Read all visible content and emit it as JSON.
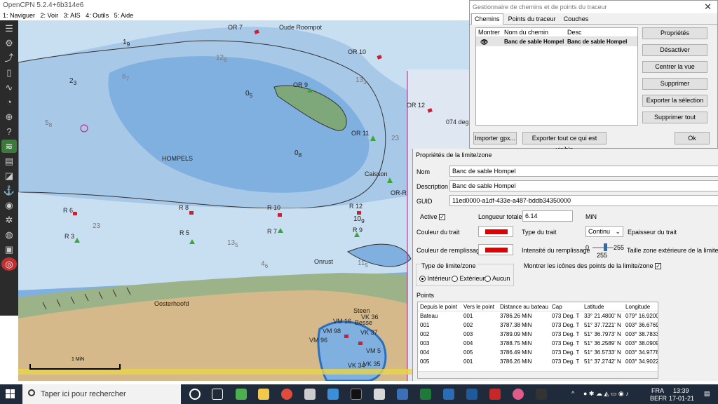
{
  "app": {
    "title": "OpenCPN 5.2.4+6b314e6",
    "menu": [
      "1: Naviguer",
      "2: Voir",
      "3: AIS",
      "4: Outils",
      "5: Aide"
    ]
  },
  "toolbar": {
    "icons": [
      "menu-icon",
      "settings-icon",
      "route-icon",
      "waypoint-icon",
      "track-icon",
      "ownship-icon",
      "zoom-in-icon",
      "help-icon",
      "tide-icon",
      "chart-icon",
      "layers-icon",
      "ais-icon",
      "mob-icon"
    ]
  },
  "chart": {
    "place_names": [
      "Oude Roompot",
      "HOMPELS",
      "Caisson",
      "Onrust",
      "Oosterhoofd",
      "Steen"
    ],
    "buoys": [
      "OR 7",
      "OR 10",
      "OR 9",
      "OR 12",
      "OR 11",
      "OR-R",
      "R 6",
      "R 8",
      "R 10",
      "R 12",
      "R 3",
      "R 5",
      "R 7",
      "R 9",
      "VM 16",
      "VM 98",
      "VM 96",
      "VM 5",
      "VK 34",
      "VK 37",
      "VK 35",
      "VK 36",
      "Besse"
    ],
    "bearing_label": "074 deg",
    "scale_label": "1 MiN"
  },
  "route_manager": {
    "title": "Gestionnaire de chemins et de points du traceur",
    "tabs": [
      "Chemins",
      "Points du traceur",
      "Couches"
    ],
    "columns": [
      "Montrer",
      "Nom du chemin",
      "Desc"
    ],
    "row": {
      "name": "Banc de sable Hompel",
      "desc": "Banc de sable Hompel"
    },
    "buttons": [
      "Propriétés",
      "Désactiver",
      "Centrer la vue",
      "Supprimer",
      "Exporter la sélection ...",
      "Supprimer tout"
    ],
    "bottom_buttons": {
      "import": "Importer gpx...",
      "export": "Exporter tout ce qui est visible",
      "ok": "Ok"
    }
  },
  "boundary": {
    "title": "Propriétés de la limite/zone",
    "name_label": "Nom",
    "name": "Banc de sable Hompel",
    "desc_label": "Description",
    "desc": "Banc de sable Hompel",
    "guid_label": "GUID",
    "guid": "11ed0000-a1df-433e-a487-bddb34350000",
    "active_label": "Active",
    "length_label": "Longueur totale",
    "length": "6.14",
    "length_unit": "MiN",
    "line_color_label": "Couleur du trait",
    "line_type_label": "Type du trait",
    "line_type": "Continu",
    "line_width_label": "Epaisseur du trait",
    "fill_color_label": "Couleur de remplissage",
    "fill_intensity_label": "Intensité du remplissage",
    "slider_min": "0",
    "slider_max": "255",
    "slider_value": "255",
    "outer_zone_label": "Taille zone extérieure de la limite/zone",
    "type_label": "Type de limite/zone",
    "type_options": [
      "Intérieur",
      "Extérieur",
      "Aucun"
    ],
    "show_icons_label": "Montrer les icônes des points de la limite/zone",
    "points_label": "Points",
    "points_columns": [
      "Depuis le point",
      "Vers le point",
      "Distance au bateau",
      "Cap",
      "Latitude",
      "Longitude"
    ],
    "points": [
      [
        "Bateau",
        "001",
        "3786.26 MiN",
        "073 Deg. T",
        "33° 21.4800' N",
        "079° 16.9200'"
      ],
      [
        "001",
        "002",
        "3787.38 MiN",
        "073 Deg. T",
        "51° 37.7221' N",
        "003° 36.6769'"
      ],
      [
        "002",
        "003",
        "3789.09 MiN",
        "073 Deg. T",
        "51° 36.7973' N",
        "003° 38.7833'"
      ],
      [
        "003",
        "004",
        "3788.75 MiN",
        "073 Deg. T",
        "51° 36.2589' N",
        "003° 38.0909'"
      ],
      [
        "004",
        "005",
        "3786.49 MiN",
        "073 Deg. T",
        "51° 36.5733' N",
        "003° 34.9778'"
      ],
      [
        "005",
        "001",
        "3786.26 MiN",
        "073 Deg. T",
        "51° 37.2742' N",
        "003° 34.9022'"
      ]
    ]
  },
  "taskbar": {
    "search_placeholder": "Taper ici pour rechercher",
    "lang": "FRA",
    "layout": "BEFR",
    "time": "13:39",
    "date": "17-01-21"
  }
}
